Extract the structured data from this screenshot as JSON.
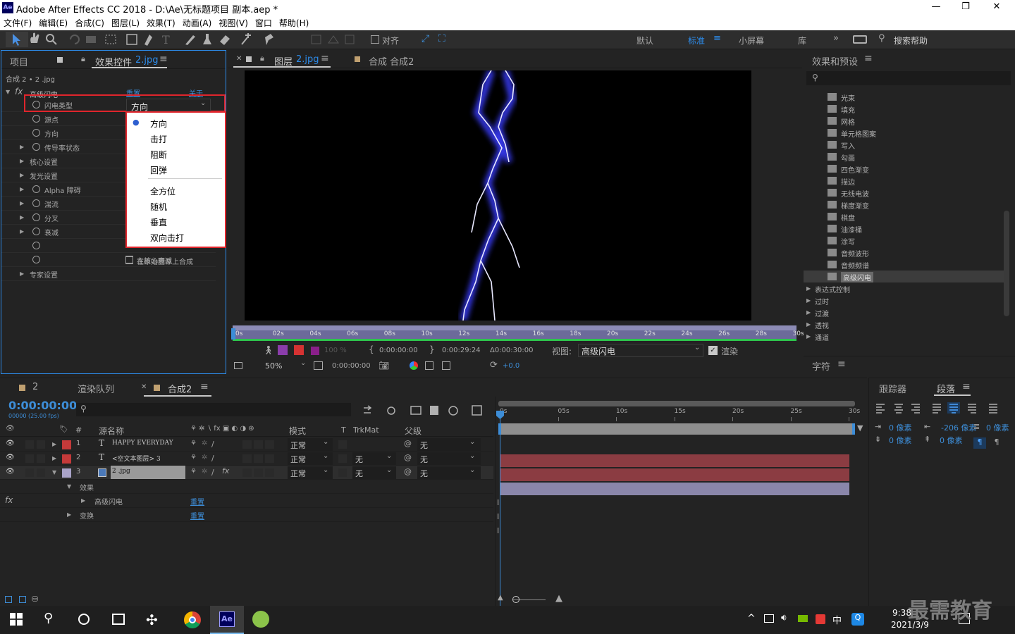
{
  "window": {
    "app_badge": "Ae",
    "title": "Adobe After Effects CC 2018 - D:\\Ae\\无标题项目 副本.aep *",
    "min": "—",
    "max": "❐",
    "close": "✕"
  },
  "menu": [
    "文件(F)",
    "编辑(E)",
    "合成(C)",
    "图层(L)",
    "效果(T)",
    "动画(A)",
    "视图(V)",
    "窗口",
    "帮助(H)"
  ],
  "toolbar": {
    "align_label": "对齐",
    "workspaces": [
      "默认",
      "标准",
      "小屏幕",
      "库"
    ],
    "active_workspace": "标准",
    "help_placeholder": "搜索帮助"
  },
  "left_panel": {
    "tab_project": "项目",
    "tab_effects": "效果控件",
    "tab_effects_file": "2.jpg",
    "breadcrumb": "合成 2 • 2 .jpg",
    "effect_name": "高级闪电",
    "reset": "重置",
    "about": "关于",
    "properties": [
      {
        "label": "闪电类型",
        "kind": "stopwatch"
      },
      {
        "label": "源点",
        "kind": "stopwatch"
      },
      {
        "label": "方向",
        "kind": "stopwatch"
      },
      {
        "label": "传导率状态",
        "kind": "group"
      },
      {
        "label": "核心设置",
        "kind": "group-nostop"
      },
      {
        "label": "发光设置",
        "kind": "group-nostop"
      },
      {
        "label": "Alpha 障碍",
        "kind": "group"
      },
      {
        "label": "湍流",
        "kind": "group"
      },
      {
        "label": "分叉",
        "kind": "group"
      },
      {
        "label": "衰减",
        "kind": "group"
      },
      {
        "label": "",
        "kind": "stopwatch-only"
      },
      {
        "label": "",
        "kind": "stopwatch-only"
      },
      {
        "label": "专家设置",
        "kind": "group-nostop"
      }
    ],
    "dropdown_value": "方向",
    "checkbox_hidden": "主核心衰减",
    "checkbox_composite": "在原始图像上合成",
    "menu_items": [
      "方向",
      "击打",
      "阻断",
      "回弹",
      "全方位",
      "随机",
      "垂直",
      "双向击打"
    ],
    "menu_selected": "方向"
  },
  "viewer": {
    "tab_layer_prefix": "图层",
    "tab_layer_file": "2.jpg",
    "tab_comp": "合成 合成2",
    "ruler": [
      "0s",
      "02s",
      "04s",
      "06s",
      "08s",
      "10s",
      "12s",
      "14s",
      "16s",
      "18s",
      "20s",
      "22s",
      "24s",
      "26s",
      "28s",
      "30s"
    ],
    "opacity": "100 %",
    "time_in": "0:00:00:00",
    "time_out": "0:00:29:24",
    "duration": "Δ0:00:30:00",
    "view_label": "视图:",
    "view_value": "高级闪电",
    "render_label": "渲染",
    "zoom": "50%",
    "current_time": "0:00:00:00",
    "exposure": "+0.0"
  },
  "effects_panel": {
    "title": "效果和预设",
    "items": [
      "光束",
      "填充",
      "网格",
      "单元格图案",
      "写入",
      "勾画",
      "四色渐变",
      "描边",
      "无线电波",
      "梯度渐变",
      "棋盘",
      "油漆桶",
      "涂写",
      "音频波形",
      "音频频谱",
      "高级闪电"
    ],
    "selected": "高级闪电",
    "groups": [
      "表达式控制",
      "过时",
      "过渡",
      "透视",
      "通道"
    ]
  },
  "char_panel": {
    "title": "字符"
  },
  "paragraph_panel": {
    "tab_tracker": "跟踪器",
    "tab_paragraph": "段落",
    "indent_left": "0 像素",
    "indent_first": "-206 像素",
    "indent_right": "0 像素",
    "space_before": "0 像素",
    "space_after": "0 像素"
  },
  "timeline": {
    "tab_2": "2",
    "tab_render": "渲染队列",
    "tab_comp": "合成2",
    "timecode": "0:00:00:00",
    "timecode_sub": "00000 (25.00 fps)",
    "columns": {
      "num": "#",
      "source": "源名称",
      "mode": "模式",
      "t": "T",
      "trkmat": "TrkMat",
      "parent": "父级"
    },
    "layers": [
      {
        "num": "1",
        "type": "T",
        "name": "HAPPY EVERYDAY",
        "mode": "正常",
        "trkmat": "",
        "parent": "无",
        "color": "#c43a3a"
      },
      {
        "num": "2",
        "type": "T",
        "name": "<空文本图层> 3",
        "mode": "正常",
        "trkmat": "无",
        "parent": "无",
        "color": "#c43a3a"
      },
      {
        "num": "3",
        "type": "img",
        "name": "2 .jpg",
        "mode": "正常",
        "trkmat": "无",
        "parent": "无",
        "color": "#a9a3c8"
      }
    ],
    "sub_effects": "效果",
    "sub_lightning": "高级闪电",
    "sub_transform": "变换",
    "reset": "重置",
    "ruler": [
      "0s",
      "05s",
      "10s",
      "15s",
      "20s",
      "25s",
      "30s"
    ]
  },
  "taskbar": {
    "time": "9:38",
    "date": "2021/3/9",
    "ime": "中",
    "watermark": "最需教育"
  }
}
